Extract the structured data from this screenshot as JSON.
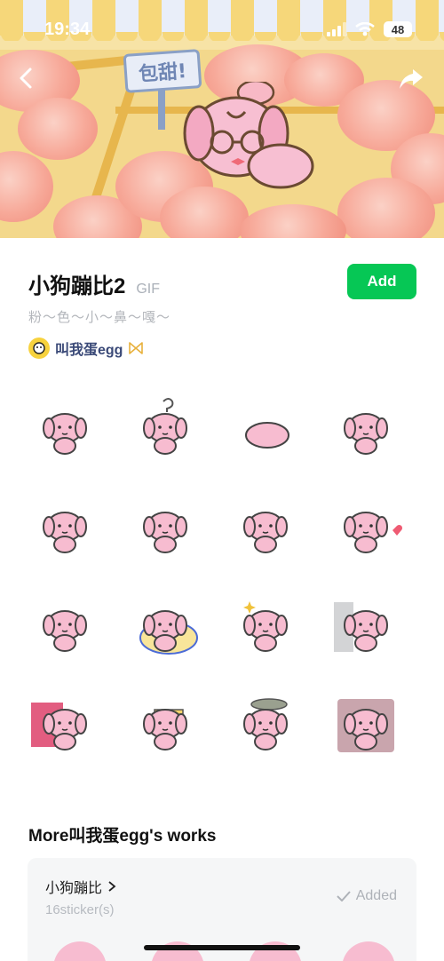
{
  "status_bar": {
    "time": "19:34",
    "battery": "48"
  },
  "banner": {
    "sign_text": "包甜!"
  },
  "pack": {
    "title": "小狗蹦比2",
    "format_tag": "GIF",
    "add_label": "Add",
    "subtitle": "粉～色～小～鼻～嘎～",
    "author": "叫我蛋egg"
  },
  "stickers": [
    {
      "expression": "crying"
    },
    {
      "expression": "question"
    },
    {
      "expression": "lying"
    },
    {
      "expression": "shy"
    },
    {
      "expression": "glasses"
    },
    {
      "expression": "smile"
    },
    {
      "expression": "grumpy"
    },
    {
      "expression": "heart"
    },
    {
      "expression": "pout"
    },
    {
      "expression": "blanket"
    },
    {
      "expression": "sparkle"
    },
    {
      "expression": "door-peek"
    },
    {
      "expression": "doorway"
    },
    {
      "expression": "cake"
    },
    {
      "expression": "ufo"
    },
    {
      "expression": "window"
    }
  ],
  "more_works": {
    "title": "More叫我蛋egg's works",
    "item": {
      "name": "小狗蹦比",
      "count": "16sticker(s)",
      "status": "Added"
    }
  },
  "colors": {
    "accent": "#06c755",
    "author": "#3b4a78",
    "sticker_pink": "#f7bcd0"
  }
}
